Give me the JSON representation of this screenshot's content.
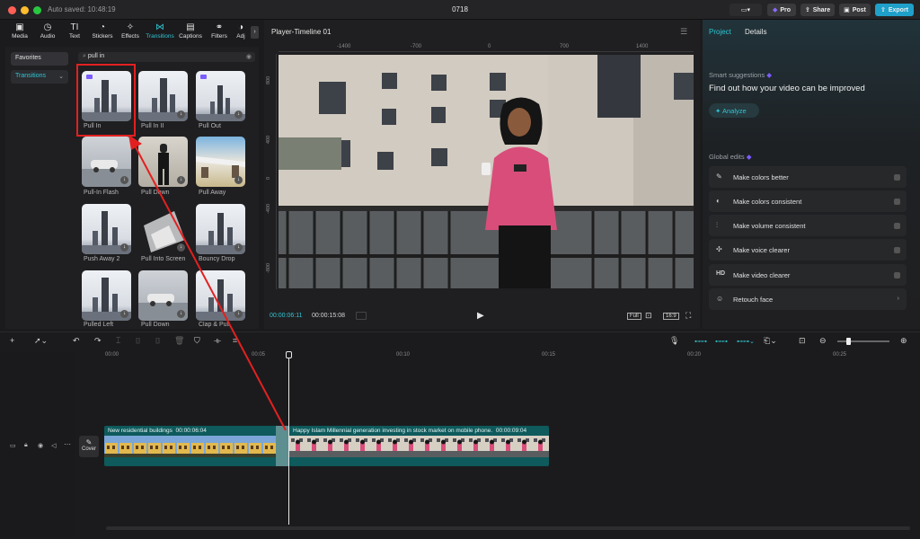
{
  "titlebar": {
    "autosaved": "Auto saved: 10:48:19",
    "project_name": "0718",
    "pro_label": "Pro",
    "share_label": "Share",
    "post_label": "Post",
    "export_label": "Export"
  },
  "tool_tabs": [
    {
      "label": "Media",
      "icon": "media-icon"
    },
    {
      "label": "Audio",
      "icon": "audio-icon"
    },
    {
      "label": "Text",
      "icon": "text-icon"
    },
    {
      "label": "Stickers",
      "icon": "stickers-icon"
    },
    {
      "label": "Effects",
      "icon": "effects-icon"
    },
    {
      "label": "Transitions",
      "icon": "transitions-icon"
    },
    {
      "label": "Captions",
      "icon": "captions-icon"
    },
    {
      "label": "Filters",
      "icon": "filters-icon"
    },
    {
      "label": "Adj",
      "icon": "adjust-icon"
    }
  ],
  "sidebar": {
    "favorites": "Favorites",
    "transitions": "Transitions"
  },
  "search": {
    "value": "pull in"
  },
  "transitions": [
    {
      "label": "Pull In"
    },
    {
      "label": "Pull In II"
    },
    {
      "label": "Pull Out"
    },
    {
      "label": "Pull-In Flash"
    },
    {
      "label": "Pull Down"
    },
    {
      "label": "Pull Away"
    },
    {
      "label": "Push Away 2"
    },
    {
      "label": "Pull Into Screen"
    },
    {
      "label": "Bouncy Drop"
    },
    {
      "label": "Pulled Left"
    },
    {
      "label": "Pull Down"
    },
    {
      "label": "Clap & Pull"
    }
  ],
  "player": {
    "title": "Player-Timeline 01",
    "ruler_top": [
      "-1400",
      "-700",
      "0",
      "700",
      "1400"
    ],
    "ruler_left": [
      "800",
      "400",
      "0",
      "-400",
      "-800"
    ],
    "current_time": "00:00:06:11",
    "total_time": "00:00:15:08",
    "full_label": "Full",
    "ratio_label": "16:9"
  },
  "right_panel": {
    "tab_project": "Project",
    "tab_details": "Details",
    "smart_title": "Smart suggestions",
    "smart_heading": "Find out how your video can be improved",
    "analyze_label": "Analyze",
    "global_title": "Global edits",
    "edits": [
      {
        "label": "Make colors better",
        "icon": "magic-wand-icon"
      },
      {
        "label": "Make colors consistent",
        "icon": "color-match-icon"
      },
      {
        "label": "Make volume consistent",
        "icon": "volume-sliders-icon"
      },
      {
        "label": "Make voice clearer",
        "icon": "voice-icon"
      },
      {
        "label": "Make video clearer",
        "icon": "hd-icon",
        "glyph": "HD"
      },
      {
        "label": "Retouch face",
        "icon": "retouch-icon"
      }
    ]
  },
  "timeline": {
    "ruler": [
      "00:00",
      "00:05",
      "00:10",
      "00:15",
      "00:20",
      "00:25"
    ],
    "cover_label": "Cover",
    "clip1": {
      "title": "New residential buildings",
      "duration": "00:00:06:04"
    },
    "clip2": {
      "title": "Happy Islam Millennial generation investing in stock market on mobile phone.",
      "duration": "00:00:09:04"
    }
  },
  "colors": {
    "accent": "#2fc5d3",
    "export_button": "#1fa0c9",
    "highlight_box": "#e32020",
    "clip": "#0e5a5c"
  }
}
